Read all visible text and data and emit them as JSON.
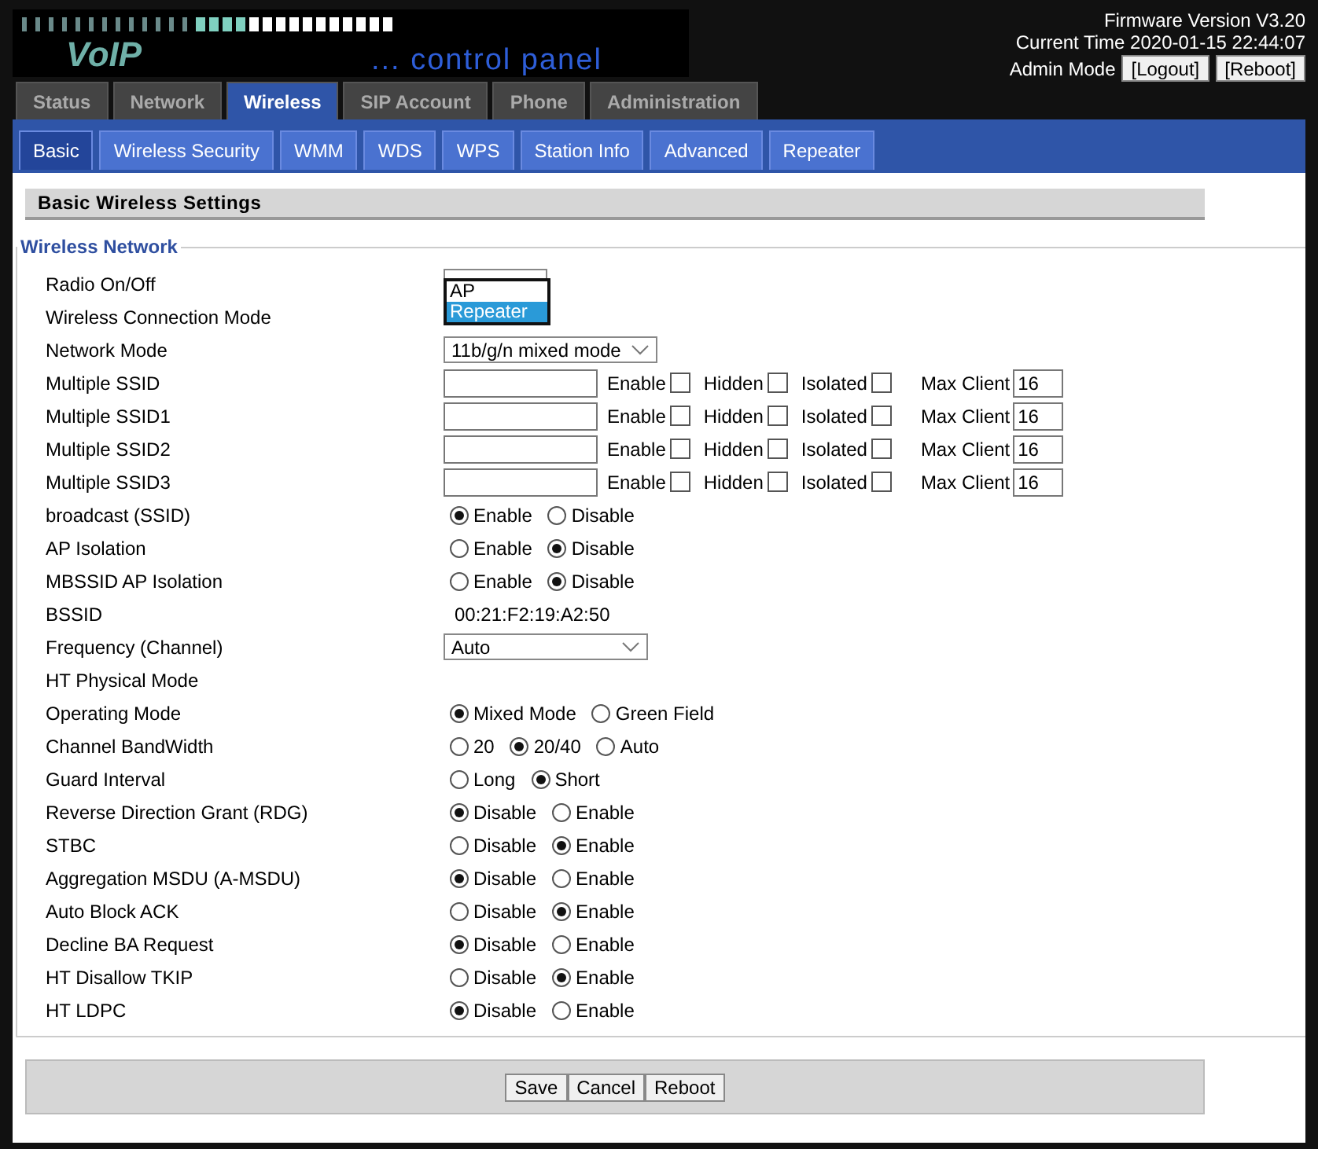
{
  "header": {
    "logo_title": "VoIP",
    "logo_subtitle": "... control panel",
    "firmware": "Firmware Version V3.20",
    "time": "Current Time 2020-01-15 22:44:07",
    "mode_label": "Admin Mode",
    "buttons": [
      "[Logout]",
      "[Reboot]"
    ]
  },
  "main_tabs": [
    {
      "label": "Status",
      "selected": false
    },
    {
      "label": "Network",
      "selected": false
    },
    {
      "label": "Wireless",
      "selected": true
    },
    {
      "label": "SIP Account",
      "selected": false
    },
    {
      "label": "Phone",
      "selected": false
    },
    {
      "label": "Administration",
      "selected": false
    }
  ],
  "sub_tabs": [
    {
      "label": "Basic",
      "selected": true
    },
    {
      "label": "Wireless Security",
      "selected": false
    },
    {
      "label": "WMM",
      "selected": false
    },
    {
      "label": "WDS",
      "selected": false
    },
    {
      "label": "WPS",
      "selected": false
    },
    {
      "label": "Station Info",
      "selected": false
    },
    {
      "label": "Advanced",
      "selected": false
    },
    {
      "label": "Repeater",
      "selected": false
    }
  ],
  "section_title": "Basic Wireless Settings",
  "fieldset_legend": "Wireless Network",
  "rows": [
    {
      "kind": "select_open",
      "label": "Radio On/Off",
      "options": [
        {
          "label": "AP",
          "selected": false
        },
        {
          "label": "Repeater",
          "selected": true
        }
      ]
    },
    {
      "kind": "none",
      "label": "Wireless Connection Mode"
    },
    {
      "kind": "select",
      "label": "Network Mode",
      "value": "11b/g/n mixed mode"
    },
    {
      "kind": "ssid",
      "label": "Multiple SSID",
      "checks": [
        {
          "label": "Enable",
          "checked": false
        },
        {
          "label": "Hidden",
          "checked": false
        },
        {
          "label": "Isolated",
          "checked": false
        }
      ],
      "max_label": "Max Client",
      "max_value": "16"
    },
    {
      "kind": "ssid",
      "label": "Multiple SSID1",
      "checks": [
        {
          "label": "Enable",
          "checked": false
        },
        {
          "label": "Hidden",
          "checked": false
        },
        {
          "label": "Isolated",
          "checked": false
        }
      ],
      "max_label": "Max Client",
      "max_value": "16"
    },
    {
      "kind": "ssid",
      "label": "Multiple SSID2",
      "checks": [
        {
          "label": "Enable",
          "checked": false
        },
        {
          "label": "Hidden",
          "checked": false
        },
        {
          "label": "Isolated",
          "checked": false
        }
      ],
      "max_label": "Max Client",
      "max_value": "16"
    },
    {
      "kind": "ssid",
      "label": "Multiple SSID3",
      "checks": [
        {
          "label": "Enable",
          "checked": false
        },
        {
          "label": "Hidden",
          "checked": false
        },
        {
          "label": "Isolated",
          "checked": false
        }
      ],
      "max_label": "Max Client",
      "max_value": "16"
    },
    {
      "kind": "radio",
      "label": "broadcast (SSID)",
      "options": [
        {
          "label": "Enable",
          "selected": true
        },
        {
          "label": "Disable",
          "selected": false
        }
      ]
    },
    {
      "kind": "radio",
      "label": "AP Isolation",
      "options": [
        {
          "label": "Enable",
          "selected": false
        },
        {
          "label": "Disable",
          "selected": true
        }
      ]
    },
    {
      "kind": "radio",
      "label": "MBSSID AP Isolation",
      "options": [
        {
          "label": "Enable",
          "selected": false
        },
        {
          "label": "Disable",
          "selected": true
        }
      ]
    },
    {
      "kind": "text",
      "label": "BSSID",
      "value": "00:21:F2:19:A2:50"
    },
    {
      "kind": "select_wide",
      "label": "Frequency (Channel)",
      "value": "Auto"
    },
    {
      "kind": "none",
      "label": "HT Physical Mode"
    },
    {
      "kind": "radio",
      "label": "Operating Mode",
      "options": [
        {
          "label": "Mixed Mode",
          "selected": true
        },
        {
          "label": "Green Field",
          "selected": false
        }
      ]
    },
    {
      "kind": "radio",
      "label": "Channel BandWidth",
      "options": [
        {
          "label": "20",
          "selected": false
        },
        {
          "label": "20/40",
          "selected": true
        },
        {
          "label": "Auto",
          "selected": false
        }
      ]
    },
    {
      "kind": "radio",
      "label": "Guard Interval",
      "options": [
        {
          "label": "Long",
          "selected": false
        },
        {
          "label": "Short",
          "selected": true
        }
      ]
    },
    {
      "kind": "radio",
      "label": "Reverse Direction Grant (RDG)",
      "options": [
        {
          "label": "Disable",
          "selected": true
        },
        {
          "label": "Enable",
          "selected": false
        }
      ]
    },
    {
      "kind": "radio",
      "label": "STBC",
      "options": [
        {
          "label": "Disable",
          "selected": false
        },
        {
          "label": "Enable",
          "selected": true
        }
      ]
    },
    {
      "kind": "radio",
      "label": "Aggregation MSDU (A-MSDU)",
      "options": [
        {
          "label": "Disable",
          "selected": true
        },
        {
          "label": "Enable",
          "selected": false
        }
      ]
    },
    {
      "kind": "radio",
      "label": "Auto Block ACK",
      "options": [
        {
          "label": "Disable",
          "selected": false
        },
        {
          "label": "Enable",
          "selected": true
        }
      ]
    },
    {
      "kind": "radio",
      "label": "Decline BA Request",
      "options": [
        {
          "label": "Disable",
          "selected": true
        },
        {
          "label": "Enable",
          "selected": false
        }
      ]
    },
    {
      "kind": "radio",
      "label": "HT Disallow TKIP",
      "options": [
        {
          "label": "Disable",
          "selected": false
        },
        {
          "label": "Enable",
          "selected": true
        }
      ]
    },
    {
      "kind": "radio",
      "label": "HT LDPC",
      "options": [
        {
          "label": "Disable",
          "selected": true
        },
        {
          "label": "Enable",
          "selected": false
        }
      ]
    }
  ],
  "footer_buttons": [
    "Save",
    "Cancel",
    "Reboot"
  ]
}
